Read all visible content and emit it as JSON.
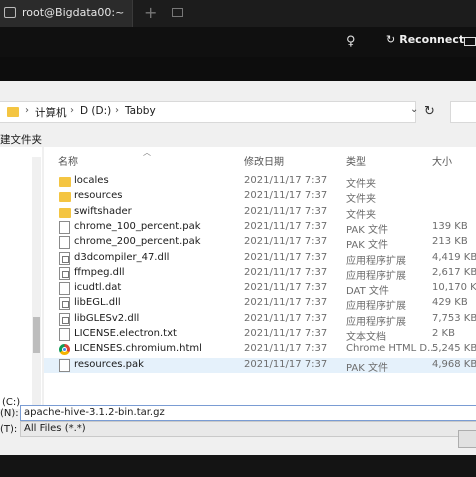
{
  "tab": {
    "title": "root@Bigdata00:~",
    "new_tab_glyph": "+",
    "icon": "terminal-icon"
  },
  "toolbar": {
    "bulb_glyph": "♀",
    "reconnect_icon": "↻",
    "reconnect_label": "Reconnect"
  },
  "address": {
    "breadcrumb": [
      "计算机",
      "D (D:)",
      "Tabby"
    ],
    "separator": "›",
    "dropdown_glyph": "⌄",
    "refresh_glyph": "↻"
  },
  "commands": {
    "new_folder": "建文件夹"
  },
  "columns": {
    "name": "名称",
    "date": "修改日期",
    "type": "类型",
    "size": "大小"
  },
  "files": [
    {
      "name": "locales",
      "date": "2021/11/17 7:37",
      "type": "文件夹",
      "size": "",
      "icon": "folder"
    },
    {
      "name": "resources",
      "date": "2021/11/17 7:37",
      "type": "文件夹",
      "size": "",
      "icon": "folder"
    },
    {
      "name": "swiftshader",
      "date": "2021/11/17 7:37",
      "type": "文件夹",
      "size": "",
      "icon": "folder"
    },
    {
      "name": "chrome_100_percent.pak",
      "date": "2021/11/17 7:37",
      "type": "PAK 文件",
      "size": "139 KB",
      "icon": "file"
    },
    {
      "name": "chrome_200_percent.pak",
      "date": "2021/11/17 7:37",
      "type": "PAK 文件",
      "size": "213 KB",
      "icon": "file"
    },
    {
      "name": "d3dcompiler_47.dll",
      "date": "2021/11/17 7:37",
      "type": "应用程序扩展",
      "size": "4,419 KB",
      "icon": "app"
    },
    {
      "name": "ffmpeg.dll",
      "date": "2021/11/17 7:37",
      "type": "应用程序扩展",
      "size": "2,617 KB",
      "icon": "app"
    },
    {
      "name": "icudtl.dat",
      "date": "2021/11/17 7:37",
      "type": "DAT 文件",
      "size": "10,170 KB",
      "icon": "file"
    },
    {
      "name": "libEGL.dll",
      "date": "2021/11/17 7:37",
      "type": "应用程序扩展",
      "size": "429 KB",
      "icon": "app"
    },
    {
      "name": "libGLESv2.dll",
      "date": "2021/11/17 7:37",
      "type": "应用程序扩展",
      "size": "7,753 KB",
      "icon": "app"
    },
    {
      "name": "LICENSE.electron.txt",
      "date": "2021/11/17 7:37",
      "type": "文本文档",
      "size": "2 KB",
      "icon": "file"
    },
    {
      "name": "LICENSES.chromium.html",
      "date": "2021/11/17 7:37",
      "type": "Chrome HTML D...",
      "size": "5,245 KB",
      "icon": "chrome"
    },
    {
      "name": "resources.pak",
      "date": "2021/11/17 7:37",
      "type": "PAK 文件",
      "size": "4,968 KB",
      "icon": "file",
      "selected": true
    }
  ],
  "nav": {
    "drive_label": "(C:)"
  },
  "filename": {
    "label": "(N):",
    "value": "apache-hive-3.1.2-bin.tar.gz"
  },
  "filetype": {
    "label": "(T):",
    "value": "All Files (*.*)"
  }
}
